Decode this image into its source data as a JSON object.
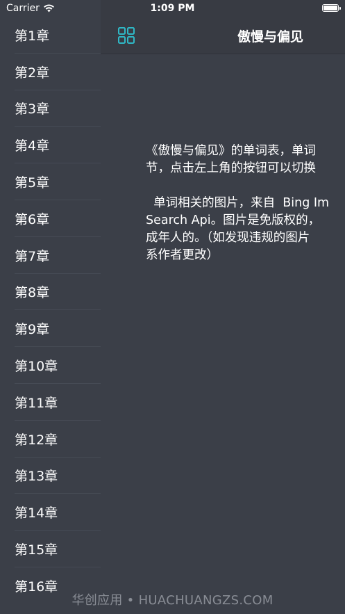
{
  "status_bar": {
    "carrier": "Carrier",
    "time": "1:09 PM"
  },
  "sidebar": {
    "items": [
      {
        "label": "第1章"
      },
      {
        "label": "第2章"
      },
      {
        "label": "第3章"
      },
      {
        "label": "第4章"
      },
      {
        "label": "第5章"
      },
      {
        "label": "第6章"
      },
      {
        "label": "第7章"
      },
      {
        "label": "第8章"
      },
      {
        "label": "第9章"
      },
      {
        "label": "第10章"
      },
      {
        "label": "第11章"
      },
      {
        "label": "第12章"
      },
      {
        "label": "第13章"
      },
      {
        "label": "第14章"
      },
      {
        "label": "第15章"
      },
      {
        "label": "第16章"
      }
    ]
  },
  "nav": {
    "title": "傲慢与偏见",
    "menu_icon": "grid-icon",
    "menu_icon_color": "#2fb8c6"
  },
  "content": {
    "paragraph1": "《傲慢与偏见》的单词表，单词\n节，点击左上角的按钮可以切换",
    "paragraph2": "  单词相关的图片，来自  Bing Im\nSearch Api。图片是免版权的，\n成年人的。（如发现违规的图片\n系作者更改）"
  },
  "watermark": "华创应用 • HUACHUANGZS.COM"
}
